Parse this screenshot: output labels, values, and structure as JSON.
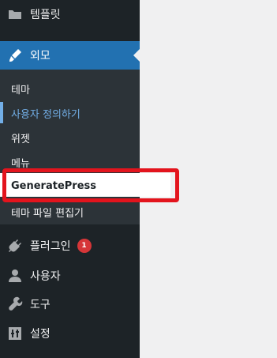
{
  "sidebar": {
    "templates": {
      "label": "템플릿",
      "icon": "folder-icon"
    },
    "appearance": {
      "label": "외모",
      "icon": "paintbrush-icon"
    },
    "submenu": [
      {
        "label": "테마"
      },
      {
        "label": "사용자 정의하기"
      },
      {
        "label": "위젯"
      },
      {
        "label": "메뉴"
      },
      {
        "label": "GeneratePress"
      },
      {
        "label": "테마 파일 편집기"
      }
    ],
    "plugins": {
      "label": "플러그인",
      "badge": "1",
      "icon": "plugin-icon"
    },
    "users": {
      "label": "사용자",
      "icon": "user-icon"
    },
    "tools": {
      "label": "도구",
      "icon": "wrench-icon"
    },
    "settings": {
      "label": "설정",
      "icon": "settings-icon"
    }
  },
  "colors": {
    "sidebar_bg": "#1d2327",
    "submenu_bg": "#2c3338",
    "active_bg": "#2271b1",
    "highlight_border": "#e3141d",
    "badge_bg": "#d63638"
  }
}
